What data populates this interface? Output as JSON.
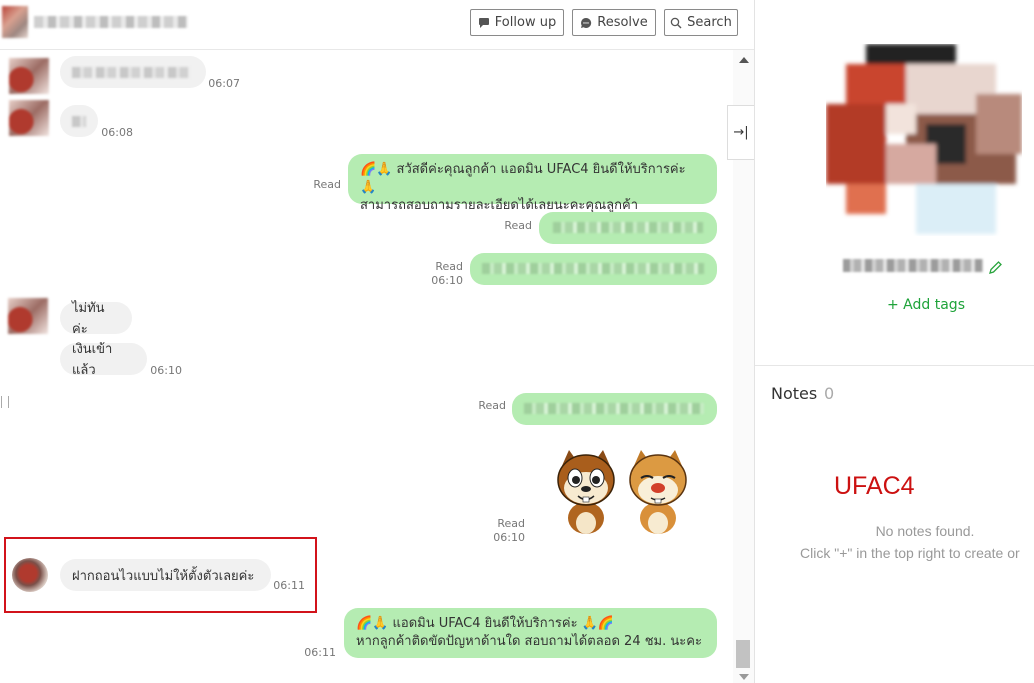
{
  "header": {
    "follow_up": "Follow up",
    "resolve": "Resolve",
    "search": "Search"
  },
  "messages": {
    "t1": "06:07",
    "t2": "06:08",
    "read1": "Read",
    "msg1_line1": "🌈🙏 สวัสดีค่ะคุณลูกค้า แอดมิน UFAC4 ยินดีให้บริการค่ะ 🙏",
    "msg1_line2": "สามารถสอบถามรายละเอียดได้เลยนะคะคุณลูกค้า",
    "read2": "Read",
    "read3": "Read",
    "t3": "06:10",
    "user_msg_a": "ไม่ทันค่ะ",
    "user_msg_b": "เงินเข้าแล้ว",
    "t4": "06:10",
    "read4": "Read",
    "read5": "Read",
    "t5": "06:10",
    "user_msg_c": "ฝากถอนไวแบบไม่ให้ตั้งตัวเลยค่ะ",
    "t6": "06:11",
    "msg2_line1": "🌈🙏 แอดมิน UFAC4 ยินดีให้บริการค่ะ 🙏🌈",
    "msg2_line2": "หากลูกค้าติดขัดปัญหาด้านใด สอบถามได้ตลอด 24 ชม. นะคะ",
    "t7": "06:11"
  },
  "sidebar": {
    "add_tags": "+ Add tags",
    "notes_label": "Notes",
    "notes_count": "0",
    "brand": "UFAC4",
    "no_notes": "No notes found.",
    "hint": "Click \"+\" in the top right to create or"
  },
  "colors": {
    "accent_green": "#1fa33a",
    "bubble_green": "#b5ecb2",
    "brand_red": "#cc1111",
    "highlight_red": "#d2131b"
  }
}
